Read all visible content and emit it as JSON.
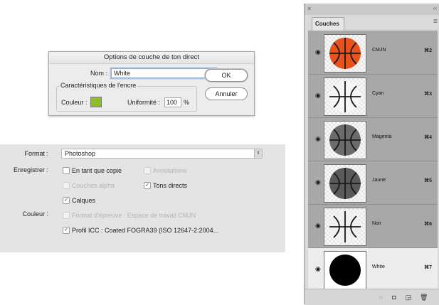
{
  "dialog": {
    "title": "Options de couche de ton direct",
    "name_label": "Nom :",
    "name_value": "White",
    "ink_group_label": "Caractéristiques de l'encre",
    "color_label": "Couleur :",
    "color_swatch": "#8dbd2a",
    "solidity_label": "Uniformité :",
    "solidity_value": "100",
    "percent": "%",
    "ok_label": "OK",
    "cancel_label": "Annuler"
  },
  "save": {
    "format_label": "Format :",
    "format_value": "Photoshop",
    "save_label": "Enregistrer :",
    "as_copy": "En tant que copie",
    "annotations": "Annotations",
    "alpha_channels": "Couches alpha",
    "spot_colors": "Tons directs",
    "layers": "Calques",
    "color_label": "Couleur :",
    "proof_format": "Format d'épreuve : Espace de travail CMJN",
    "icc_profile": "Profil ICC : Coated FOGRA39 (ISO 12647-2:2004..."
  },
  "channels": {
    "close_glyph": "×",
    "collapse_glyph": "‹‹",
    "tab_label": "Couches",
    "menu_glyph": "≡",
    "rows": [
      {
        "name": "CMJN",
        "shortcut": "⌘2"
      },
      {
        "name": "Cyan",
        "shortcut": "⌘3"
      },
      {
        "name": "Magenta",
        "shortcut": "⌘4"
      },
      {
        "name": "Jaune",
        "shortcut": "⌘5"
      },
      {
        "name": "Noir",
        "shortcut": "⌘6"
      },
      {
        "name": "White",
        "shortcut": "⌘7"
      }
    ]
  }
}
